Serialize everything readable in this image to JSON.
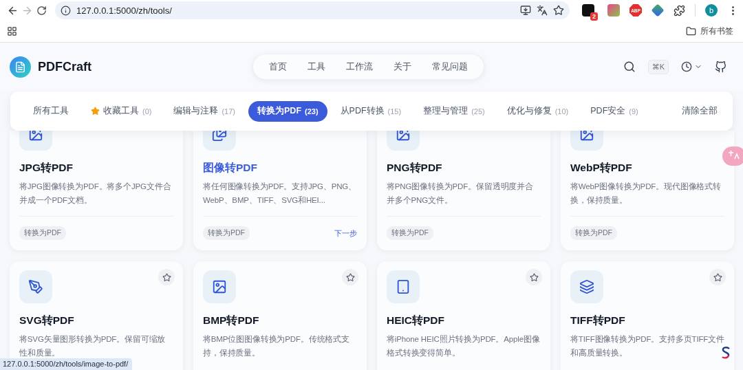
{
  "browser": {
    "url": "127.0.0.1:5000/zh/tools/",
    "extension_badge": "2",
    "adblock_label": "ABP",
    "profile_initial": "b",
    "bookmarks_folder": "所有书签"
  },
  "header": {
    "brand": "PDFCraft",
    "nav": [
      "首页",
      "工具",
      "工作流",
      "关于",
      "常见问题"
    ],
    "shortcut": "⌘K"
  },
  "filters": {
    "tabs": [
      {
        "kind": "plain",
        "label": "所有工具",
        "selected": false
      },
      {
        "kind": "favorites",
        "label": "收藏工具",
        "count": "(0)",
        "selected": false
      },
      {
        "kind": "plain",
        "label": "编辑与注释",
        "count": "(17)",
        "selected": false
      },
      {
        "kind": "plain",
        "label": "转换为PDF",
        "count": "(23)",
        "selected": true
      },
      {
        "kind": "plain",
        "label": "从PDF转换",
        "count": "(15)",
        "selected": false
      },
      {
        "kind": "plain",
        "label": "整理与管理",
        "count": "(25)",
        "selected": false
      },
      {
        "kind": "plain",
        "label": "优化与修复",
        "count": "(10)",
        "selected": false
      },
      {
        "kind": "plain",
        "label": "PDF安全",
        "count": "(9)",
        "selected": false
      }
    ],
    "clear": "清除全部"
  },
  "cards": [
    {
      "title": "JPG转PDF",
      "description": "将JPG图像转换为PDF。将多个JPG文件合并成一个PDF文档。",
      "tag": "转换为PDF",
      "hovered": false
    },
    {
      "title": "图像转PDF",
      "description": "将任何图像转换为PDF。支持JPG、PNG、WebP、BMP、TIFF、SVG和HEI...",
      "tag": "转换为PDF",
      "hovered": true,
      "action": "下一步"
    },
    {
      "title": "PNG转PDF",
      "description": "将PNG图像转换为PDF。保留透明度并合并多个PNG文件。",
      "tag": "转换为PDF",
      "hovered": false
    },
    {
      "title": "WebP转PDF",
      "description": "将WebP图像转换为PDF。现代图像格式转换，保持质量。",
      "tag": "转换为PDF",
      "hovered": false
    },
    {
      "title": "SVG转PDF",
      "description": "将SVG矢量图形转换为PDF。保留可缩放性和质量。",
      "hovered": false,
      "favorite": false
    },
    {
      "title": "BMP转PDF",
      "description": "将BMP位图图像转换为PDF。传统格式支持，保持质量。",
      "hovered": false,
      "favorite": false
    },
    {
      "title": "HEIC转PDF",
      "description": "将iPhone HEIC照片转换为PDF。Apple图像格式转换变得简单。",
      "hovered": false,
      "favorite": false
    },
    {
      "title": "TIFF转PDF",
      "description": "将TIFF图像转换为PDF。支持多页TIFF文件和高质量转换。",
      "hovered": false,
      "favorite": false
    }
  ],
  "status_url": "127.0.0.1:5000/zh/tools/image-to-pdf/"
}
